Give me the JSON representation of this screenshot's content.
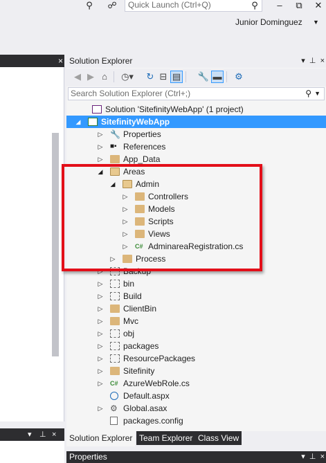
{
  "titlebar": {
    "quick_launch_placeholder": "Quick Launch (Ctrl+Q)",
    "user_name": "Junior Dominguez",
    "icons": [
      "filter-icon",
      "feedback-icon",
      "search-icon",
      "minimize-icon",
      "restore-icon",
      "close-icon"
    ]
  },
  "left_panel": {
    "close_glyph": "×",
    "bottom_header_glyphs": [
      "▾",
      "⊥",
      "×"
    ]
  },
  "solution_explorer": {
    "title": "Solution Explorer",
    "header_glyphs": [
      "▾",
      "⊥",
      "×"
    ],
    "search_placeholder": "Search Solution Explorer (Ctrl+;)",
    "toolbar_icons": [
      "back-icon",
      "forward-icon",
      "home-icon",
      "history-icon",
      "refresh-icon",
      "collapse-all-icon",
      "show-all-files-icon",
      "properties-icon",
      "preview-icon",
      "settings-icon"
    ],
    "tree": [
      {
        "label": "Solution 'SitefinityWebApp' (1 project)",
        "indent": 0,
        "expander": "",
        "icon": "solution"
      },
      {
        "label": "SitefinityWebApp",
        "indent": 0,
        "expander": "◢",
        "icon": "project",
        "selected": true
      },
      {
        "label": "Properties",
        "indent": 1,
        "expander": "▷",
        "icon": "wrench"
      },
      {
        "label": "References",
        "indent": 1,
        "expander": "▷",
        "icon": "references"
      },
      {
        "label": "App_Data",
        "indent": 1,
        "expander": "▷",
        "icon": "folder"
      },
      {
        "label": "Areas",
        "indent": 1,
        "expander": "◢",
        "icon": "folder-open"
      },
      {
        "label": "Admin",
        "indent": 2,
        "expander": "◢",
        "icon": "folder-open"
      },
      {
        "label": "Controllers",
        "indent": 3,
        "expander": "▷",
        "icon": "folder"
      },
      {
        "label": "Models",
        "indent": 3,
        "expander": "▷",
        "icon": "folder"
      },
      {
        "label": "Scripts",
        "indent": 3,
        "expander": "▷",
        "icon": "folder"
      },
      {
        "label": "Views",
        "indent": 3,
        "expander": "▷",
        "icon": "folder"
      },
      {
        "label": "AdminareaRegistration.cs",
        "indent": 3,
        "expander": "▷",
        "icon": "cs"
      },
      {
        "label": "Process",
        "indent": 2,
        "expander": "▷",
        "icon": "folder"
      },
      {
        "label": "Backup",
        "indent": 1,
        "expander": "▷",
        "icon": "folder-empty"
      },
      {
        "label": "bin",
        "indent": 1,
        "expander": "▷",
        "icon": "folder-empty"
      },
      {
        "label": "Build",
        "indent": 1,
        "expander": "▷",
        "icon": "folder-empty"
      },
      {
        "label": "ClientBin",
        "indent": 1,
        "expander": "▷",
        "icon": "folder"
      },
      {
        "label": "Mvc",
        "indent": 1,
        "expander": "▷",
        "icon": "folder"
      },
      {
        "label": "obj",
        "indent": 1,
        "expander": "▷",
        "icon": "folder-empty"
      },
      {
        "label": "packages",
        "indent": 1,
        "expander": "▷",
        "icon": "folder-empty"
      },
      {
        "label": "ResourcePackages",
        "indent": 1,
        "expander": "▷",
        "icon": "folder-empty"
      },
      {
        "label": "Sitefinity",
        "indent": 1,
        "expander": "▷",
        "icon": "folder"
      },
      {
        "label": "AzureWebRole.cs",
        "indent": 1,
        "expander": "▷",
        "icon": "cs"
      },
      {
        "label": "Default.aspx",
        "indent": 1,
        "expander": "",
        "icon": "globe"
      },
      {
        "label": "Global.asax",
        "indent": 1,
        "expander": "▷",
        "icon": "gear"
      },
      {
        "label": "packages.config",
        "indent": 1,
        "expander": "",
        "icon": "doc"
      }
    ],
    "tabs": [
      {
        "label": "Solution Explorer",
        "active": true
      },
      {
        "label": "Team Explorer",
        "active": false
      },
      {
        "label": "Class View",
        "active": false
      }
    ]
  },
  "properties_panel": {
    "title": "Properties",
    "header_glyphs": [
      "▾",
      "⊥",
      "×"
    ]
  },
  "colors": {
    "selection": "#3399ff",
    "highlight_box": "#e30f19",
    "dark_header": "#2d2d30",
    "folder": "#dcb67a"
  }
}
